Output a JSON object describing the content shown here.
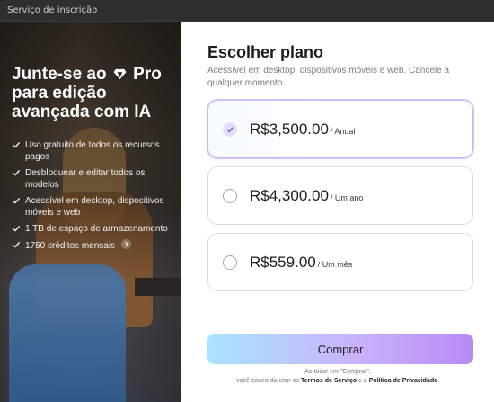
{
  "window": {
    "title": "Serviço de inscrição"
  },
  "promo": {
    "headline_part1": "Junte-se ao",
    "headline_pro": "Pro",
    "headline_part2": "para edição avançada com IA",
    "features": [
      "Uso gratuito de todos os recursos pagos",
      "Desbloquear e editar todos os modelos",
      "Acessível em desktop, dispositivos móveis e web",
      "1 TB de espaço de armazenamento",
      "1750 créditos mensais"
    ],
    "carousel": {
      "count": 7,
      "active_index": 6
    }
  },
  "plans": {
    "title": "Escolher plano",
    "subtitle": "Acessível em desktop, dispositivos móveis e web. Cancele a qualquer momento.",
    "options": [
      {
        "price": "R$3,500.00",
        "period": "/ Anual",
        "selected": true
      },
      {
        "price": "R$4,300.00",
        "period": "/ Um ano",
        "selected": false
      },
      {
        "price": "R$559.00",
        "period": "/ Um mês",
        "selected": false
      }
    ],
    "buy_label": "Comprar",
    "legal_line1": "Ao tocar em \"Comprar\",",
    "legal_prefix": "você concorda com os",
    "legal_terms": "Termos de Serviço",
    "legal_and": "e a",
    "legal_privacy": "Política de Privacidade",
    "legal_suffix": "."
  },
  "colors": {
    "accent_gradient_start": "#a8e4ff",
    "accent_gradient_end": "#b98af5",
    "selected_border": "#c8b8f0"
  }
}
